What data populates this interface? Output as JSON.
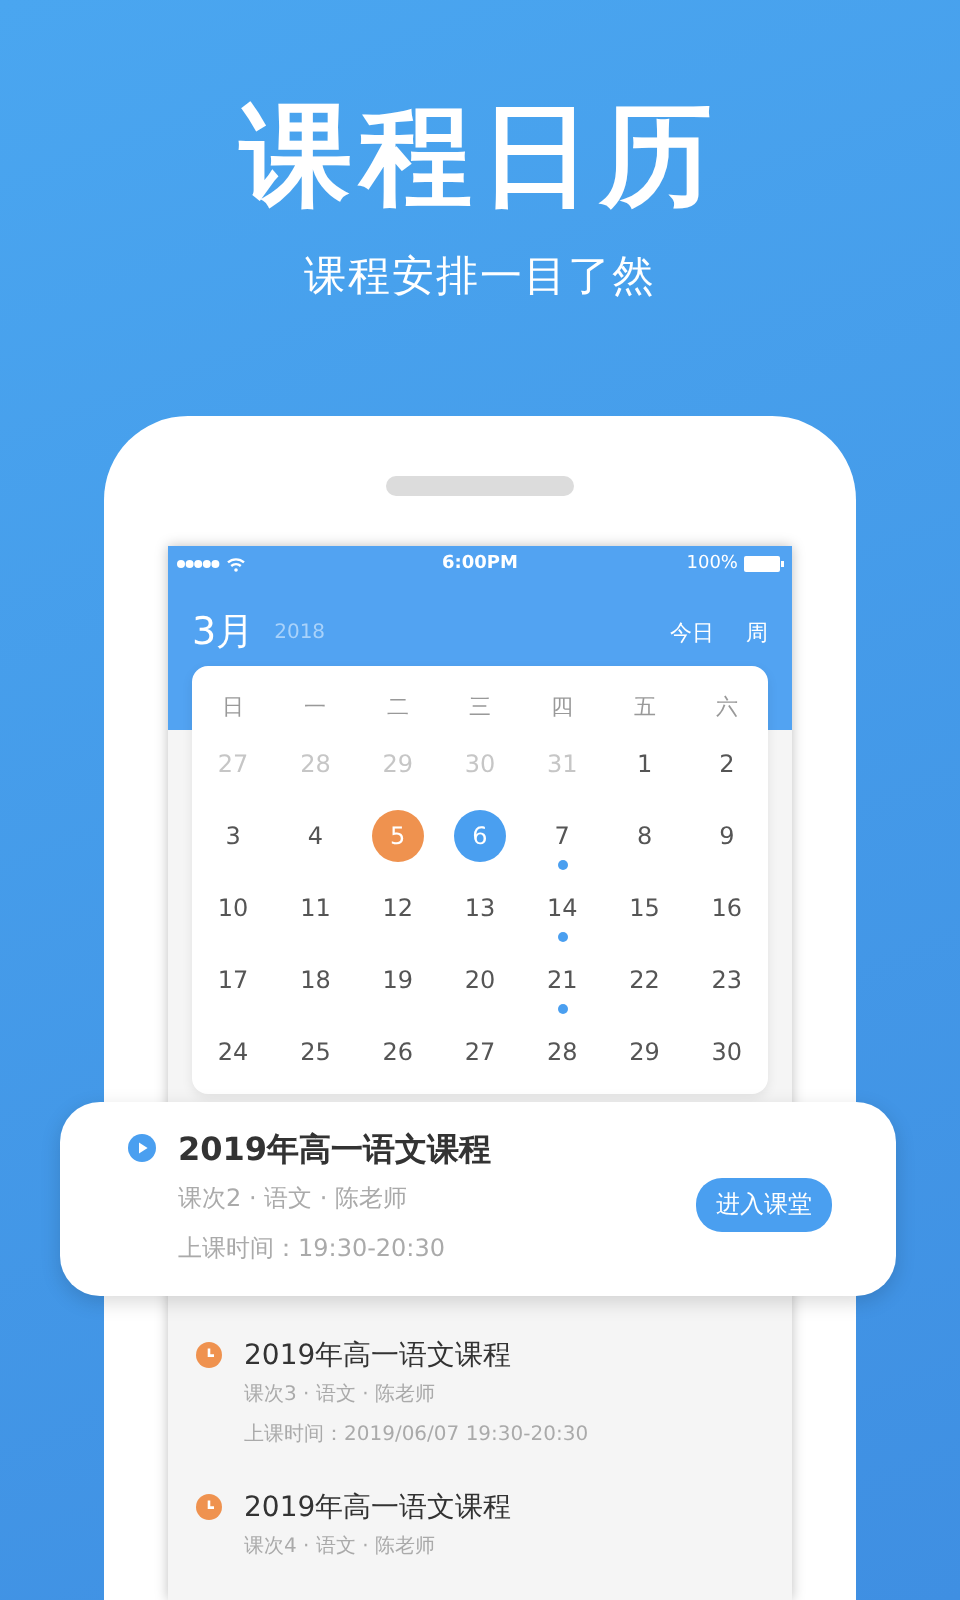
{
  "headline": "课程日历",
  "tagline": "课程安排一目了然",
  "status_bar": {
    "time": "6:00PM",
    "battery": "100%"
  },
  "header": {
    "month": "3月",
    "year": "2018",
    "actions": [
      "今日",
      "周"
    ]
  },
  "calendar": {
    "weekdays": [
      "日",
      "一",
      "二",
      "三",
      "四",
      "五",
      "六"
    ],
    "weeks": [
      [
        {
          "day": "27",
          "muted": true,
          "dot": false
        },
        {
          "day": "28",
          "muted": true,
          "dot": false
        },
        {
          "day": "29",
          "muted": true,
          "dot": false
        },
        {
          "day": "30",
          "muted": true,
          "dot": false
        },
        {
          "day": "31",
          "muted": true,
          "dot": false
        },
        {
          "day": "1",
          "muted": false,
          "dot": false
        },
        {
          "day": "2",
          "muted": false,
          "dot": false
        }
      ],
      [
        {
          "day": "3",
          "muted": false,
          "dot": false
        },
        {
          "day": "4",
          "muted": false,
          "dot": false
        },
        {
          "day": "5",
          "muted": false,
          "dot": false,
          "color": "#ef924f"
        },
        {
          "day": "6",
          "muted": false,
          "dot": false,
          "color": "#4a9ff0"
        },
        {
          "day": "7",
          "muted": false,
          "dot": true
        },
        {
          "day": "8",
          "muted": false,
          "dot": false
        },
        {
          "day": "9",
          "muted": false,
          "dot": false
        }
      ],
      [
        {
          "day": "10",
          "muted": false,
          "dot": false
        },
        {
          "day": "11",
          "muted": false,
          "dot": false
        },
        {
          "day": "12",
          "muted": false,
          "dot": false
        },
        {
          "day": "13",
          "muted": false,
          "dot": false
        },
        {
          "day": "14",
          "muted": false,
          "dot": true
        },
        {
          "day": "15",
          "muted": false,
          "dot": false
        },
        {
          "day": "16",
          "muted": false,
          "dot": false
        }
      ],
      [
        {
          "day": "17",
          "muted": false,
          "dot": false
        },
        {
          "day": "18",
          "muted": false,
          "dot": false
        },
        {
          "day": "19",
          "muted": false,
          "dot": false
        },
        {
          "day": "20",
          "muted": false,
          "dot": false
        },
        {
          "day": "21",
          "muted": false,
          "dot": true
        },
        {
          "day": "22",
          "muted": false,
          "dot": false
        },
        {
          "day": "23",
          "muted": false,
          "dot": false
        }
      ],
      [
        {
          "day": "24",
          "muted": false,
          "dot": false
        },
        {
          "day": "25",
          "muted": false,
          "dot": false
        },
        {
          "day": "26",
          "muted": false,
          "dot": false
        },
        {
          "day": "27",
          "muted": false,
          "dot": false
        },
        {
          "day": "28",
          "muted": false,
          "dot": false
        },
        {
          "day": "29",
          "muted": false,
          "dot": false
        },
        {
          "day": "30",
          "muted": false,
          "dot": false
        }
      ]
    ]
  },
  "courses": [
    {
      "kind": "current",
      "title": "2019年高一语文课程",
      "info": "课次2 · 语文 · 陈老师",
      "time": "上课时间：19:30-20:30",
      "button": "进入课堂"
    },
    {
      "kind": "upcoming",
      "title": "2019年高一语文课程",
      "info": "课次3 · 语文 · 陈老师",
      "time": "上课时间：2019/06/07 19:30-20:30"
    },
    {
      "kind": "upcoming",
      "title": "2019年高一语文课程",
      "info": "课次4 · 语文 · 陈老师"
    }
  ]
}
